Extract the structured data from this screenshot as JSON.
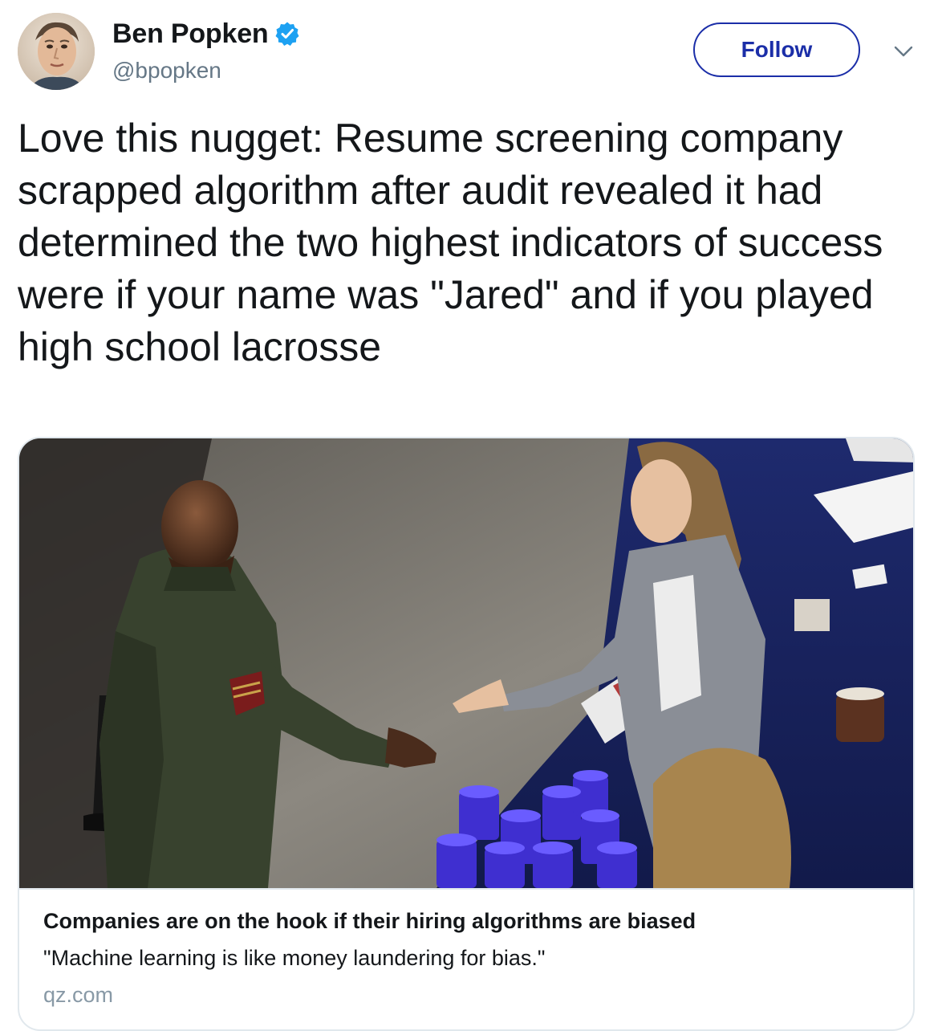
{
  "author": {
    "display_name": "Ben Popken",
    "handle": "@bpopken",
    "verified": true,
    "verified_icon": "verified-badge-icon",
    "avatar_icon": "profile-photo"
  },
  "actions": {
    "follow_label": "Follow",
    "more_icon": "chevron-down-icon"
  },
  "tweet": {
    "text": "Love this nugget: Resume screening company scrapped algorithm after audit revealed it had determined the two highest indicators of success were if your name was \"Jared\" and if you played high school lacrosse"
  },
  "card": {
    "image": "photo",
    "title": "Companies are on the hook if their hiring algorithms are biased",
    "description": "\"Machine learning is like money laundering for bias.\"",
    "domain": "qz.com"
  },
  "colors": {
    "follow_accent": "#1b2ea8",
    "verified_blue": "#1da1f2",
    "secondary_text": "#657786",
    "domain_text": "#8899a6",
    "card_border": "#e1e8ed"
  }
}
